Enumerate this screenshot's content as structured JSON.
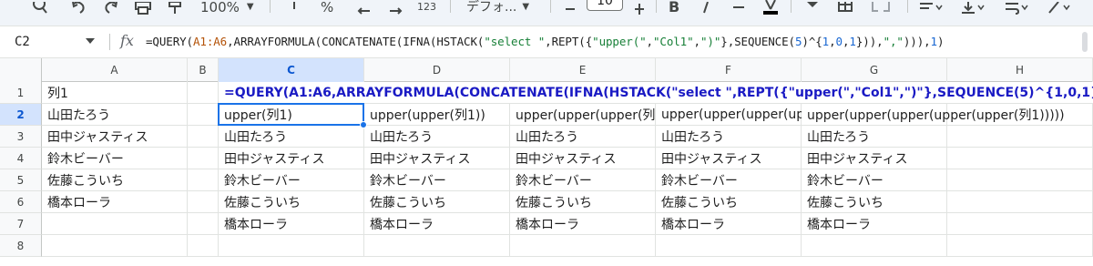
{
  "toolbar": {
    "zoom": "100%",
    "currency_symbol": "%",
    "number_format": "123",
    "font_family": "デフォ...",
    "font_size": "10",
    "bold_label": "B"
  },
  "formula_bar": {
    "cell_ref": "C2",
    "fx": "fx",
    "tokens": [
      {
        "text": "=QUERY(",
        "kind": "plain"
      },
      {
        "text": "A1:A6",
        "kind": "range"
      },
      {
        "text": ",ARRAYFORMULA(CONCATENATE(IFNA(HSTACK(",
        "kind": "plain"
      },
      {
        "text": "\"select \"",
        "kind": "str"
      },
      {
        "text": ",REPT({",
        "kind": "plain"
      },
      {
        "text": "\"upper(\"",
        "kind": "str"
      },
      {
        "text": ",",
        "kind": "plain"
      },
      {
        "text": "\"Col1\"",
        "kind": "str"
      },
      {
        "text": ",",
        "kind": "plain"
      },
      {
        "text": "\")\"",
        "kind": "str"
      },
      {
        "text": "},SEQUENCE(",
        "kind": "plain"
      },
      {
        "text": "5",
        "kind": "num"
      },
      {
        "text": ")^{",
        "kind": "plain"
      },
      {
        "text": "1",
        "kind": "num"
      },
      {
        "text": ",",
        "kind": "plain"
      },
      {
        "text": "0",
        "kind": "num"
      },
      {
        "text": ",",
        "kind": "plain"
      },
      {
        "text": "1",
        "kind": "num"
      },
      {
        "text": "})),",
        "kind": "plain"
      },
      {
        "text": "\",\"",
        "kind": "str"
      },
      {
        "text": "))),",
        "kind": "plain"
      },
      {
        "text": "1",
        "kind": "num"
      },
      {
        "text": ")",
        "kind": "plain"
      }
    ]
  },
  "grid": {
    "columns": [
      "A",
      "B",
      "C",
      "D",
      "E",
      "F",
      "G",
      "H"
    ],
    "active_column": "C",
    "rows": [
      "1",
      "2",
      "3",
      "4",
      "5",
      "6",
      "7",
      "8"
    ],
    "active_row": "2",
    "cells": {
      "A1": "列1",
      "A2": "山田たろう",
      "A3": "田中ジャスティス",
      "A4": "鈴木ビーバー",
      "A5": "佐藤こういち",
      "A6": "橋本ローラ",
      "C1": "=QUERY(A1:A6,ARRAYFORMULA(CONCATENATE(IFNA(HSTACK(\"select \",REPT({\"upper(\",\"Col1\",\")\"},SEQUENCE(5)^{1,0,1})),\",\"))),1)",
      "C2": "upper(列1)",
      "D2": "upper(upper(列1))",
      "E2": "upper(upper(upper(列1",
      "F2": "upper(upper(upper(upp",
      "G2": "upper(upper(upper(upper(upper(列1)))))",
      "C3": "山田たろう",
      "D3": "山田たろう",
      "E3": "山田たろう",
      "F3": "山田たろう",
      "G3": "山田たろう",
      "C4": "田中ジャスティス",
      "D4": "田中ジャスティス",
      "E4": "田中ジャスティス",
      "F4": "田中ジャスティス",
      "G4": "田中ジャスティス",
      "C5": "鈴木ビーバー",
      "D5": "鈴木ビーバー",
      "E5": "鈴木ビーバー",
      "F5": "鈴木ビーバー",
      "G5": "鈴木ビーバー",
      "C6": "佐藤こういち",
      "D6": "佐藤こういち",
      "E6": "佐藤こういち",
      "F6": "佐藤こういち",
      "G6": "佐藤こういち",
      "C7": "橋本ローラ",
      "D7": "橋本ローラ",
      "E7": "橋本ローラ",
      "F7": "橋本ローラ",
      "G7": "橋本ローラ"
    }
  },
  "colors": {
    "selection": "#1a73e8",
    "formula_text": "#1a1ac4",
    "active_header_bg": "#d3e3fd"
  }
}
